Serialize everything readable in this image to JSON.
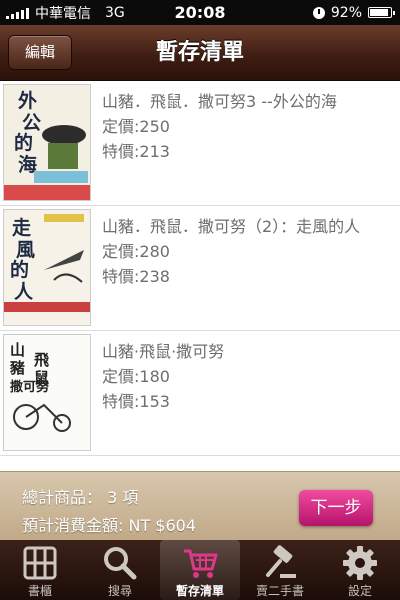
{
  "status_bar": {
    "carrier": "中華電信",
    "network": "3G",
    "time": "20:08",
    "battery": "92%",
    "battery_level": 0.92
  },
  "nav": {
    "edit_label": "編輯",
    "title": "暫存清單"
  },
  "items": [
    {
      "title": "山豬．飛鼠．撒可努3 --外公的海",
      "list_price": "定價:250",
      "special_price": "特價:213",
      "cover_text": "外公的海"
    },
    {
      "title": "山豬．飛鼠．撒可努（2）：走風的人",
      "list_price": "定價:280",
      "special_price": "特價:238",
      "cover_text": "走風的人"
    },
    {
      "title": "山豬·飛鼠·撒可努",
      "list_price": "定價:180",
      "special_price": "特價:153",
      "cover_text": "山豬飛鼠撒可努"
    }
  ],
  "summary": {
    "total_items": "總計商品：  3 項",
    "total_amount": "預計消費金額:    NT $604",
    "next_label": "下一步"
  },
  "tabs": [
    {
      "label": "書櫃",
      "icon": "bookshelf-icon"
    },
    {
      "label": "搜尋",
      "icon": "search-icon"
    },
    {
      "label": "暫存清單",
      "icon": "cart-icon",
      "selected": true
    },
    {
      "label": "賣二手書",
      "icon": "gavel-icon"
    },
    {
      "label": "設定",
      "icon": "gear-icon"
    }
  ],
  "colors": {
    "accent": "#d4287f",
    "nav_brown": "#3d1c12",
    "summary_bg": "#c9b497"
  }
}
